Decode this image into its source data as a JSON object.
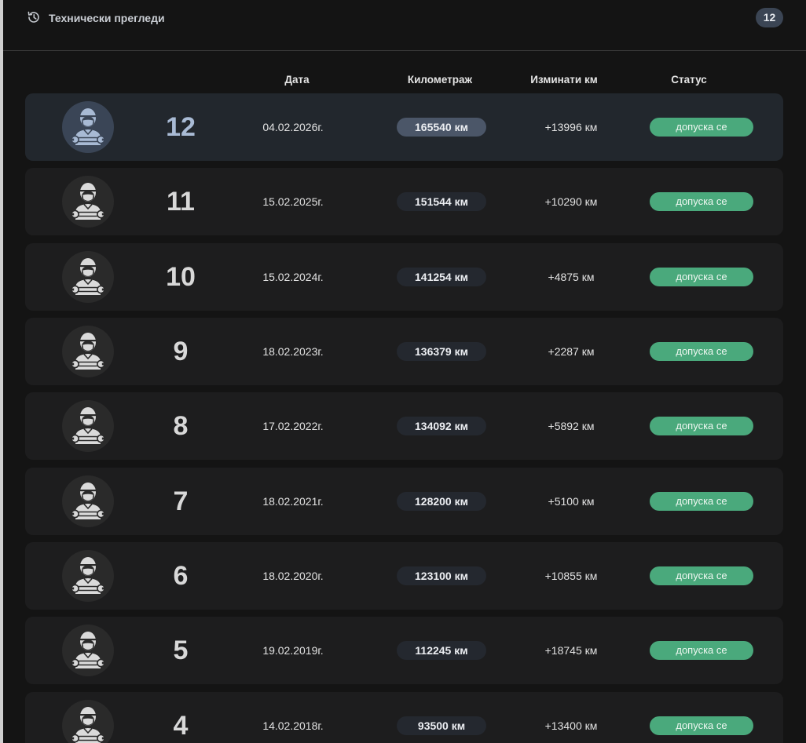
{
  "header": {
    "icon": "history-icon",
    "title": "Технически прегледи",
    "count": "12"
  },
  "columns": {
    "date": "Дата",
    "mileage": "Километраж",
    "distance": "Изминати км",
    "status": "Статус"
  },
  "avatar_icon": "mechanic-icon",
  "colors": {
    "background": "#141414",
    "row": "#1d1d1e",
    "row_highlight": "#22272d",
    "highlight_text": "#a9bbd5",
    "status_ok": "#4aa97c"
  },
  "inspections": [
    {
      "number": "12",
      "date": "04.02.2026г.",
      "mileage": "165540 км",
      "distance": "+13996 км",
      "status": "допуска се",
      "highlighted": true
    },
    {
      "number": "11",
      "date": "15.02.2025г.",
      "mileage": "151544 км",
      "distance": "+10290 км",
      "status": "допуска се",
      "highlighted": false
    },
    {
      "number": "10",
      "date": "15.02.2024г.",
      "mileage": "141254 км",
      "distance": "+4875 км",
      "status": "допуска се",
      "highlighted": false
    },
    {
      "number": "9",
      "date": "18.02.2023г.",
      "mileage": "136379 км",
      "distance": "+2287 км",
      "status": "допуска се",
      "highlighted": false
    },
    {
      "number": "8",
      "date": "17.02.2022г.",
      "mileage": "134092 км",
      "distance": "+5892 км",
      "status": "допуска се",
      "highlighted": false
    },
    {
      "number": "7",
      "date": "18.02.2021г.",
      "mileage": "128200 км",
      "distance": "+5100 км",
      "status": "допуска се",
      "highlighted": false
    },
    {
      "number": "6",
      "date": "18.02.2020г.",
      "mileage": "123100 км",
      "distance": "+10855 км",
      "status": "допуска се",
      "highlighted": false
    },
    {
      "number": "5",
      "date": "19.02.2019г.",
      "mileage": "112245 км",
      "distance": "+18745 км",
      "status": "допуска се",
      "highlighted": false
    },
    {
      "number": "4",
      "date": "14.02.2018г.",
      "mileage": "93500 км",
      "distance": "+13400 км",
      "status": "допуска се",
      "highlighted": false
    }
  ]
}
